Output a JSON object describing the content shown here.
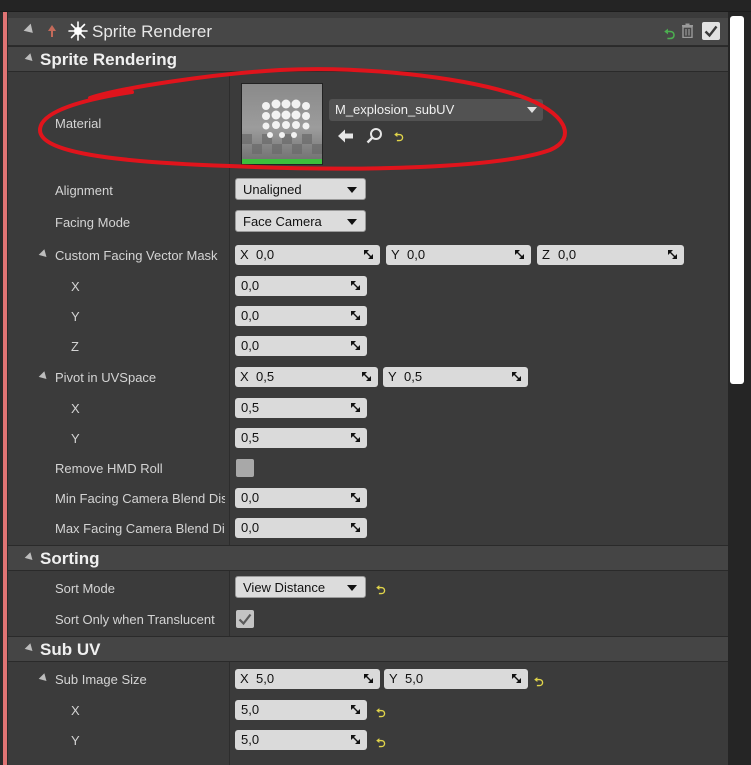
{
  "header": {
    "title": "Sprite Renderer",
    "reset_glyph": "⮌",
    "icons": [
      "triangle-collapse-icon",
      "component-icon",
      "sparkle-icon",
      "reset-icon",
      "trash-icon",
      "checkbox-icon"
    ]
  },
  "sections": {
    "sprite_rendering": "Sprite Rendering",
    "sorting": "Sorting",
    "sub_uv": "Sub UV"
  },
  "material": {
    "label": "Material",
    "asset": "M_explosion_subUV",
    "reset_glyph": "⮌"
  },
  "alignment": {
    "label": "Alignment",
    "value": "Unaligned"
  },
  "facing_mode": {
    "label": "Facing Mode",
    "value": "Face Camera"
  },
  "custom_facing_vector_mask": {
    "label": "Custom Facing Vector Mask",
    "x_axis": "X",
    "x": "0,0",
    "y_axis": "Y",
    "y": "0,0",
    "z_axis": "Z",
    "z": "0,0",
    "sub_x_label": "X",
    "sub_x": "0,0",
    "sub_y_label": "Y",
    "sub_y": "0,0",
    "sub_z_label": "Z",
    "sub_z": "0,0"
  },
  "pivot": {
    "label": "Pivot in UVSpace",
    "x_axis": "X",
    "x": "0,5",
    "y_axis": "Y",
    "y": "0,5",
    "sub_x_label": "X",
    "sub_x": "0,5",
    "sub_y_label": "Y",
    "sub_y": "0,5"
  },
  "remove_hmd_roll": {
    "label": "Remove HMD Roll",
    "checked": false
  },
  "min_facing": {
    "label": "Min Facing Camera Blend Distance",
    "value": "0,0"
  },
  "max_facing": {
    "label": "Max Facing Camera Blend Distance",
    "value": "0,0"
  },
  "sort_mode": {
    "label": "Sort Mode",
    "value": "View Distance",
    "reset_glyph": "⮌"
  },
  "sort_only_translucent": {
    "label": "Sort Only when Translucent",
    "checked": true
  },
  "sub_image_size": {
    "label": "Sub Image Size",
    "x_axis": "X",
    "x": "5,0",
    "y_axis": "Y",
    "y": "5,0",
    "sub_x_label": "X",
    "sub_x": "5,0",
    "sub_y_label": "Y",
    "sub_y": "5,0",
    "reset_glyph": "⮌"
  },
  "colors": {
    "accent": "#e07474",
    "panel": "#3b3b3b",
    "field": "#dadada",
    "reset_arrow": "#e0d44a",
    "annotation": "#e0141c"
  }
}
